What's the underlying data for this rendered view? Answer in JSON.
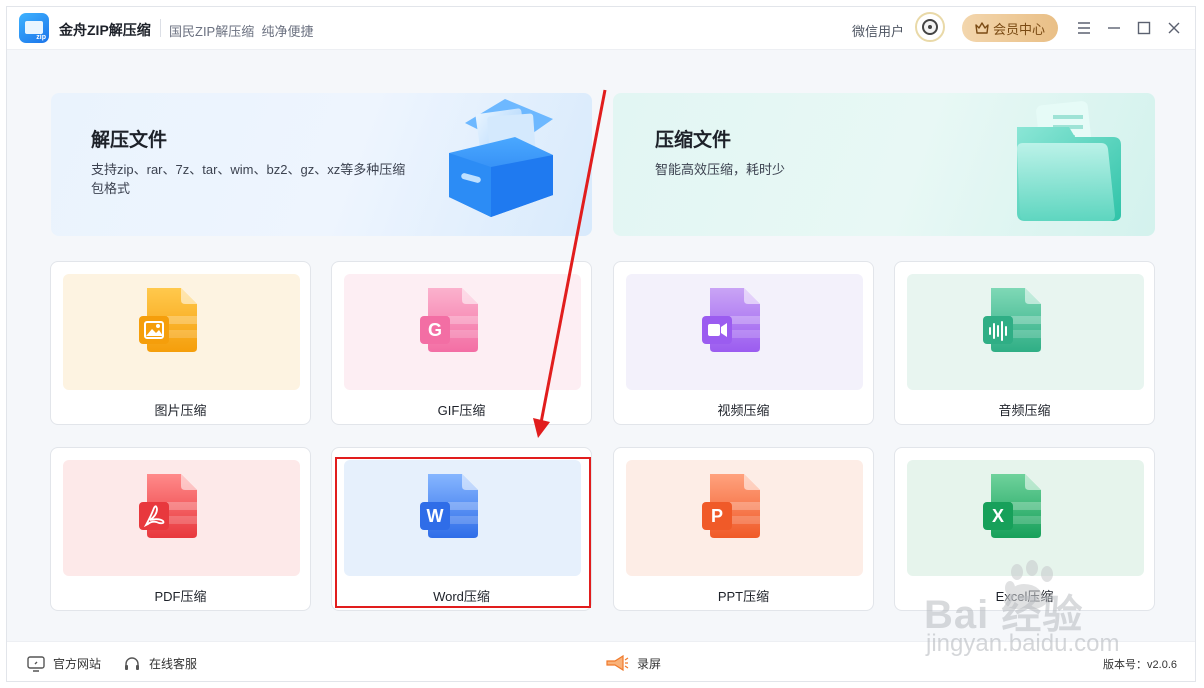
{
  "app": {
    "title": "金舟ZIP解压缩",
    "subtitle": "国民ZIP解压缩  纯净便捷",
    "user_name": "微信用户",
    "vip_label": "会员中心"
  },
  "window_controls": {
    "menu_icon": "menu-icon",
    "minimize_icon": "minimize-icon",
    "maximize_icon": "maximize-icon",
    "close_icon": "close-icon"
  },
  "hero": {
    "extract": {
      "title": "解压文件",
      "desc": "支持zip、rar、7z、tar、wim、bz2、gz、xz等多种压缩包格式"
    },
    "compress": {
      "title": "压缩文件",
      "desc": "智能高效压缩，耗时少"
    }
  },
  "tools": [
    {
      "label": "图片压缩",
      "icon": "image-file-icon",
      "glyph": "",
      "bg": "#fdf3e1",
      "c1": "#ffc94d",
      "c2": "#f59e0b"
    },
    {
      "label": "GIF压缩",
      "icon": "gif-file-icon",
      "glyph": "G",
      "bg": "#fdeef3",
      "c1": "#fbb2cd",
      "c2": "#f36ea4"
    },
    {
      "label": "视频压缩",
      "icon": "video-file-icon",
      "glyph": "",
      "bg": "#f3f1fb",
      "c1": "#c9a4f5",
      "c2": "#9b5cf0"
    },
    {
      "label": "音频压缩",
      "icon": "audio-file-icon",
      "glyph": "",
      "bg": "#e8f5f0",
      "c1": "#7fd8b6",
      "c2": "#2fae85"
    },
    {
      "label": "PDF压缩",
      "icon": "pdf-file-icon",
      "glyph": "",
      "bg": "#fde9e9",
      "c1": "#ff8a8a",
      "c2": "#e8383d"
    },
    {
      "label": "Word压缩",
      "icon": "word-file-icon",
      "glyph": "W",
      "bg": "#e6f0fc",
      "c1": "#86b6ff",
      "c2": "#2f6de8"
    },
    {
      "label": "PPT压缩",
      "icon": "ppt-file-icon",
      "glyph": "P",
      "bg": "#fdede6",
      "c1": "#ffa27e",
      "c2": "#f05a28"
    },
    {
      "label": "Excel压缩",
      "icon": "excel-file-icon",
      "glyph": "X",
      "bg": "#e6f4ec",
      "c1": "#6fd29c",
      "c2": "#17a05a"
    }
  ],
  "footer": {
    "website": "官方网站",
    "service": "在线客服",
    "record": "录屏",
    "version": "版本号：v2.0.6"
  },
  "watermark": {
    "brand": "Bai 经验",
    "url": "jingyan.baidu.com"
  },
  "colors": {
    "accent": "#2f6de8",
    "annotation_red": "#e11d1d",
    "vip_gold": "#e9bf86"
  }
}
